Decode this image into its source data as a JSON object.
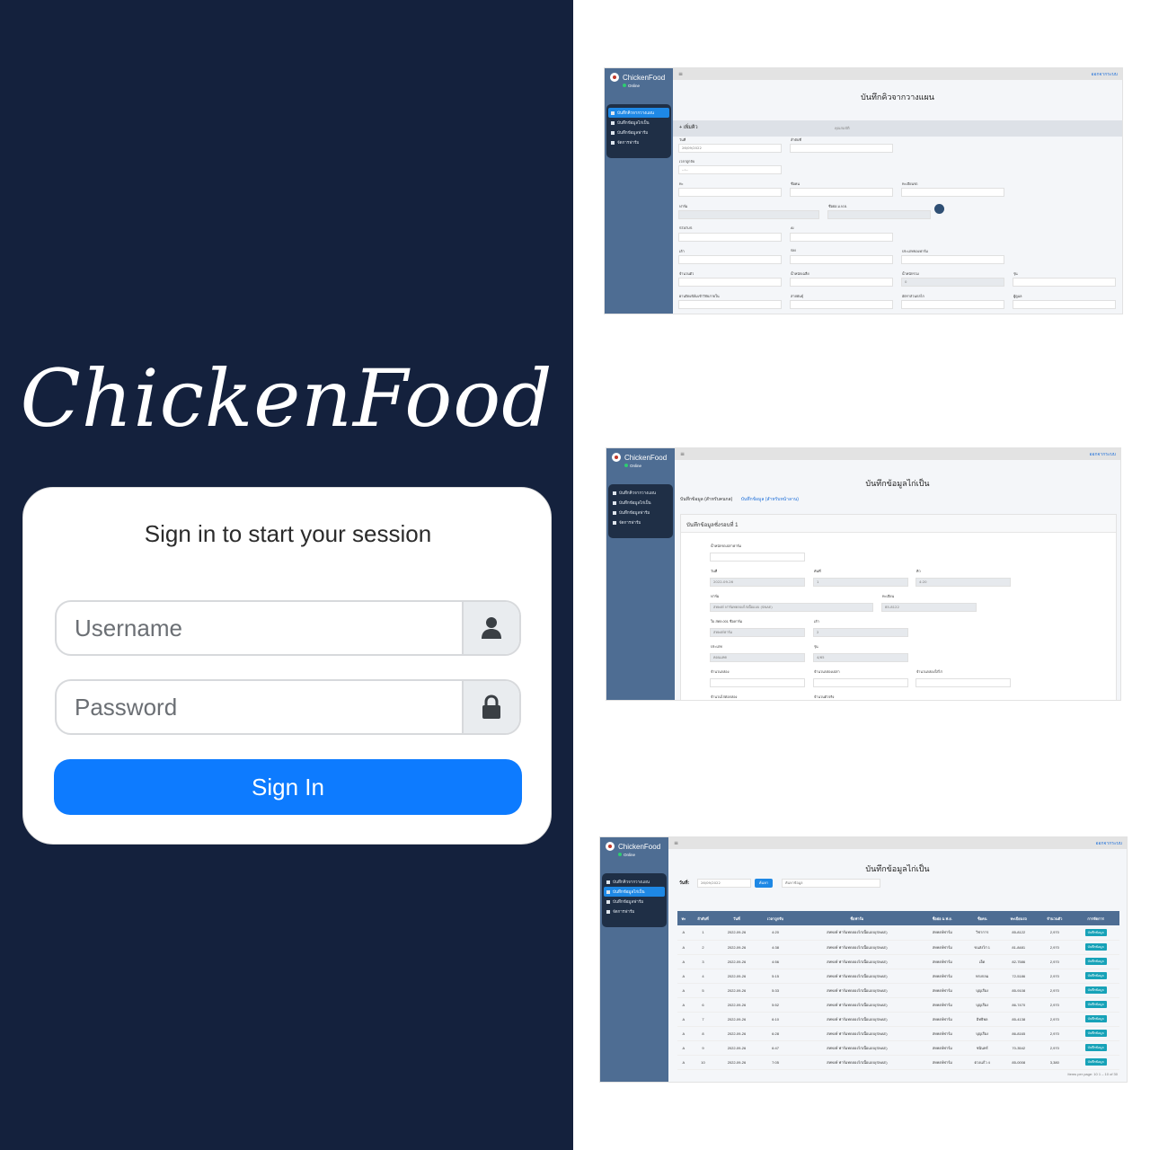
{
  "login": {
    "brand": "ChickenFood",
    "heading": "Sign in to start your session",
    "username_placeholder": "Username",
    "password_placeholder": "Password",
    "signin_label": "Sign In",
    "accent_color": "#0d7bff",
    "panel_color": "#14213d"
  },
  "app": {
    "brand": "ChickenFood",
    "status": "Online",
    "logout": "ออกจากระบบ",
    "menu": [
      "บันทึกคิวจากวางแผน",
      "บันทึกข้อมูลไก่เป็น",
      "บันทึกข้อมูลฟาร์ม",
      "จัดการฟาร์ม"
    ]
  },
  "shot1": {
    "title": "บันทึกคิวจากวางแผน",
    "add_label": "+ เพิ่มคิว",
    "bar_text": "คุณสมบัติ",
    "fields": [
      {
        "label": "วันที่",
        "value": "26/09/2022"
      },
      {
        "label": "ลำดับที่",
        "value": ""
      },
      {
        "label": "เวลาถูกจับ",
        "value": "--:--"
      },
      {
        "label": "ทะ",
        "value": ""
      },
      {
        "label": "ชื่อคน",
        "value": ""
      },
      {
        "label": "ทะเบียนรถ",
        "value": ""
      },
      {
        "label": "ฟาร์ม",
        "value": ""
      },
      {
        "label": "ชื่อย่อ ม.ฟ.ย.",
        "value": ""
      },
      {
        "label": "STATUS",
        "value": ""
      },
      {
        "label": "AI",
        "value": ""
      },
      {
        "label": "เล้า",
        "value": ""
      },
      {
        "label": "SM",
        "value": ""
      },
      {
        "label": "ประเภทของฟาร์ม",
        "value": ""
      },
      {
        "label": "จำนวนตัว",
        "value": ""
      },
      {
        "label": "น้ำหนักเฉลี่ย",
        "value": ""
      },
      {
        "label": "น้ำหนักรวม",
        "value": "0"
      },
      {
        "label": "รุ่น",
        "value": ""
      },
      {
        "label": "ผ่านปิดเฟ้ล์มเข้าวิจัยภายใน",
        "value": ""
      },
      {
        "label": "สายพันธุ์",
        "value": ""
      },
      {
        "label": "อัตราส่วนกลไก",
        "value": ""
      },
      {
        "label": "ผู้ดูแล",
        "value": ""
      }
    ]
  },
  "shot2": {
    "title": "บันทึกข้อมูลไก่เป็น",
    "tab1": "บันทึกข้อมูล (สำหรับคนกล)",
    "tab2": "บันทึกข้อมูล (สำหรับหน้าลาน)",
    "panel_title": "บันทึกข้อมูลชั่งรอบที่ 1",
    "fields": [
      {
        "label": "น้ำหนักรถเปล่าฟาร์ม",
        "value": ""
      },
      {
        "label": "วันที่",
        "value": "2022-09-26"
      },
      {
        "label": "คันที่",
        "value": "1"
      },
      {
        "label": "คิว",
        "value": "4:20"
      },
      {
        "label": "ฟาร์ม",
        "value": "สหพงษ์ ฟาร์มทดลองไก่เนื้อแบบ (SNAE)"
      },
      {
        "label": "ทะเบียน",
        "value": "85-8122"
      },
      {
        "label": "ใบ สทล.001 ชื่อฟาร์ม",
        "value": "สหพงษ์ฟาร์ม"
      },
      {
        "label": "เล้า",
        "value": "2"
      },
      {
        "label": "ประเภท",
        "value": "คอนแทค"
      },
      {
        "label": "รุ่น",
        "value": "4/65"
      },
      {
        "label": "จำนวนกล่อง",
        "value": ""
      },
      {
        "label": "จำนวนกล่องเปล่า",
        "value": ""
      },
      {
        "label": "จำนวนกล่องใส่ไก่",
        "value": ""
      },
      {
        "label": "จำนวนไก่ต่อกล่อง",
        "value": ""
      },
      {
        "label": "จำนวนตัวจริง",
        "value": ""
      }
    ]
  },
  "shot3": {
    "title": "บันทึกข้อมูลไก่เป็น",
    "date_label": "วันที่:",
    "date_value": "26/09/2022",
    "search_btn": "ค้นหา",
    "search_placeholder": "ค้นหาข้อมูล",
    "columns": [
      "ทะ",
      "ลำดับที่",
      "วันที่",
      "เวลาถูกจับ",
      "ชื่อฟาร์ม",
      "ชื่อย่อ ม.ฟ.ย.",
      "ชื่อคน",
      "ทะเบียนรถ",
      "จำนวนตัว",
      "การจัดการ"
    ],
    "action_label": "บันทึกข้อมูล",
    "rows": [
      [
        "A",
        "1",
        "2022-09-26",
        "4:20",
        "สหพงษ์ ฟาร์มทดลองไก่เนื้อแบบ(SNAE)",
        "สหพงษ์ฟาร์ม",
        "วิชาการ",
        "85-8122",
        "2,970"
      ],
      [
        "A",
        "2",
        "2022-09-26",
        "4:38",
        "สหพงษ์ ฟาร์มทดลองไก่เนื้อแบบ(SNAE)",
        "สหพงษ์ฟาร์ม",
        "ขนส่งไก่ 1",
        "81-8481",
        "2,970"
      ],
      [
        "A",
        "3",
        "2022-09-26",
        "4:56",
        "สหพงษ์ ฟาร์มทดลองไก่เนื้อแบบ(SNAE)",
        "สหพงษ์ฟาร์ม",
        "เอ็ด",
        "82-7586",
        "2,970"
      ],
      [
        "A",
        "4",
        "2022-09-26",
        "5:15",
        "สหพงษ์ ฟาร์มทดลองไก่เนื้อแบบ(SNAE)",
        "สหพงษ์ฟาร์ม",
        "ทรงกลม",
        "72-5186",
        "2,970"
      ],
      [
        "A",
        "5",
        "2022-09-26",
        "5:33",
        "สหพงษ์ ฟาร์มทดลองไก่เนื้อแบบ(SNAE)",
        "สหพงษ์ฟาร์ม",
        "บุญเรือง",
        "85-9108",
        "2,970"
      ],
      [
        "A",
        "6",
        "2022-09-26",
        "5:52",
        "สหพงษ์ ฟาร์มทดลองไก่เนื้อแบบ(SNAE)",
        "สหพงษ์ฟาร์ม",
        "บุญเรือง",
        "86-7470",
        "2,970"
      ],
      [
        "A",
        "7",
        "2022-09-26",
        "6:10",
        "สหพงษ์ ฟาร์มทดลองไก่เนื้อแบบ(SNAE)",
        "สหพงษ์ฟาร์ม",
        "อิทธิพล",
        "85-4138",
        "2,970"
      ],
      [
        "A",
        "8",
        "2022-09-26",
        "6:28",
        "สหพงษ์ ฟาร์มทดลองไก่เนื้อแบบ(SNAE)",
        "สหพงษ์ฟาร์ม",
        "บุญเรือง",
        "86-8165",
        "2,970"
      ],
      [
        "A",
        "9",
        "2022-09-26",
        "6:47",
        "สหพงษ์ ฟาร์มทดลองไก่เนื้อแบบ(SNAE)",
        "สหพงษ์ฟาร์ม",
        "ชนินทร์",
        "70-3542",
        "2,970"
      ],
      [
        "A",
        "10",
        "2022-09-26",
        "7:05",
        "สหพงษ์ ฟาร์มทดลองไก่เนื้อแบบ(SNAE)",
        "สหพงษ์ฟาร์ม",
        "ตวงแก้ว 4",
        "85-0008",
        "3,380"
      ]
    ],
    "pager": "Items per page: 10   1 – 10 of 30"
  }
}
